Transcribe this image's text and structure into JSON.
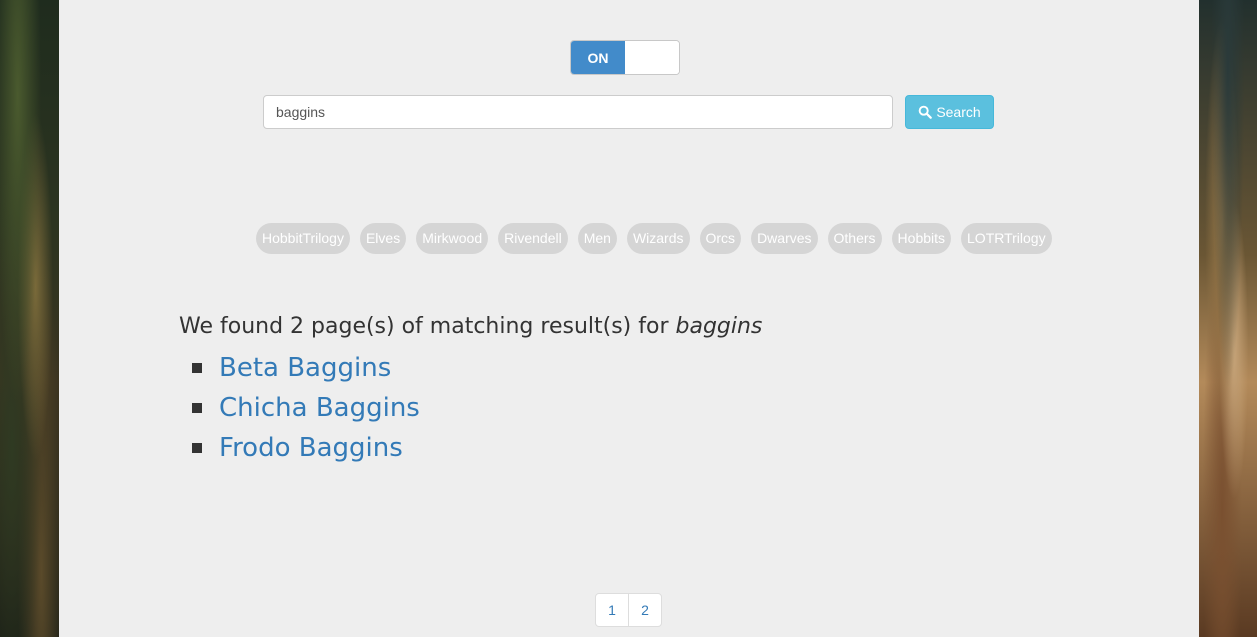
{
  "toggle": {
    "on_label": "ON",
    "state": "on",
    "accent": "#428bca"
  },
  "search": {
    "value": "baggins",
    "button_label": "Search",
    "button_icon": "search-icon",
    "button_color": "#5bc0de"
  },
  "tags": [
    "HobbitTrilogy",
    "Elves",
    "Mirkwood",
    "Rivendell",
    "Men",
    "Wizards",
    "Orcs",
    "Dwarves",
    "Others",
    "Hobbits",
    "LOTRTrilogy"
  ],
  "results": {
    "summary_prefix": "We found 2 page(s) of matching result(s) for",
    "query": "baggins",
    "items": [
      "Beta Baggins",
      "Chicha Baggins",
      "Frodo Baggins"
    ],
    "link_color": "#337ab7"
  },
  "pagination": {
    "pages": [
      "1",
      "2"
    ]
  }
}
